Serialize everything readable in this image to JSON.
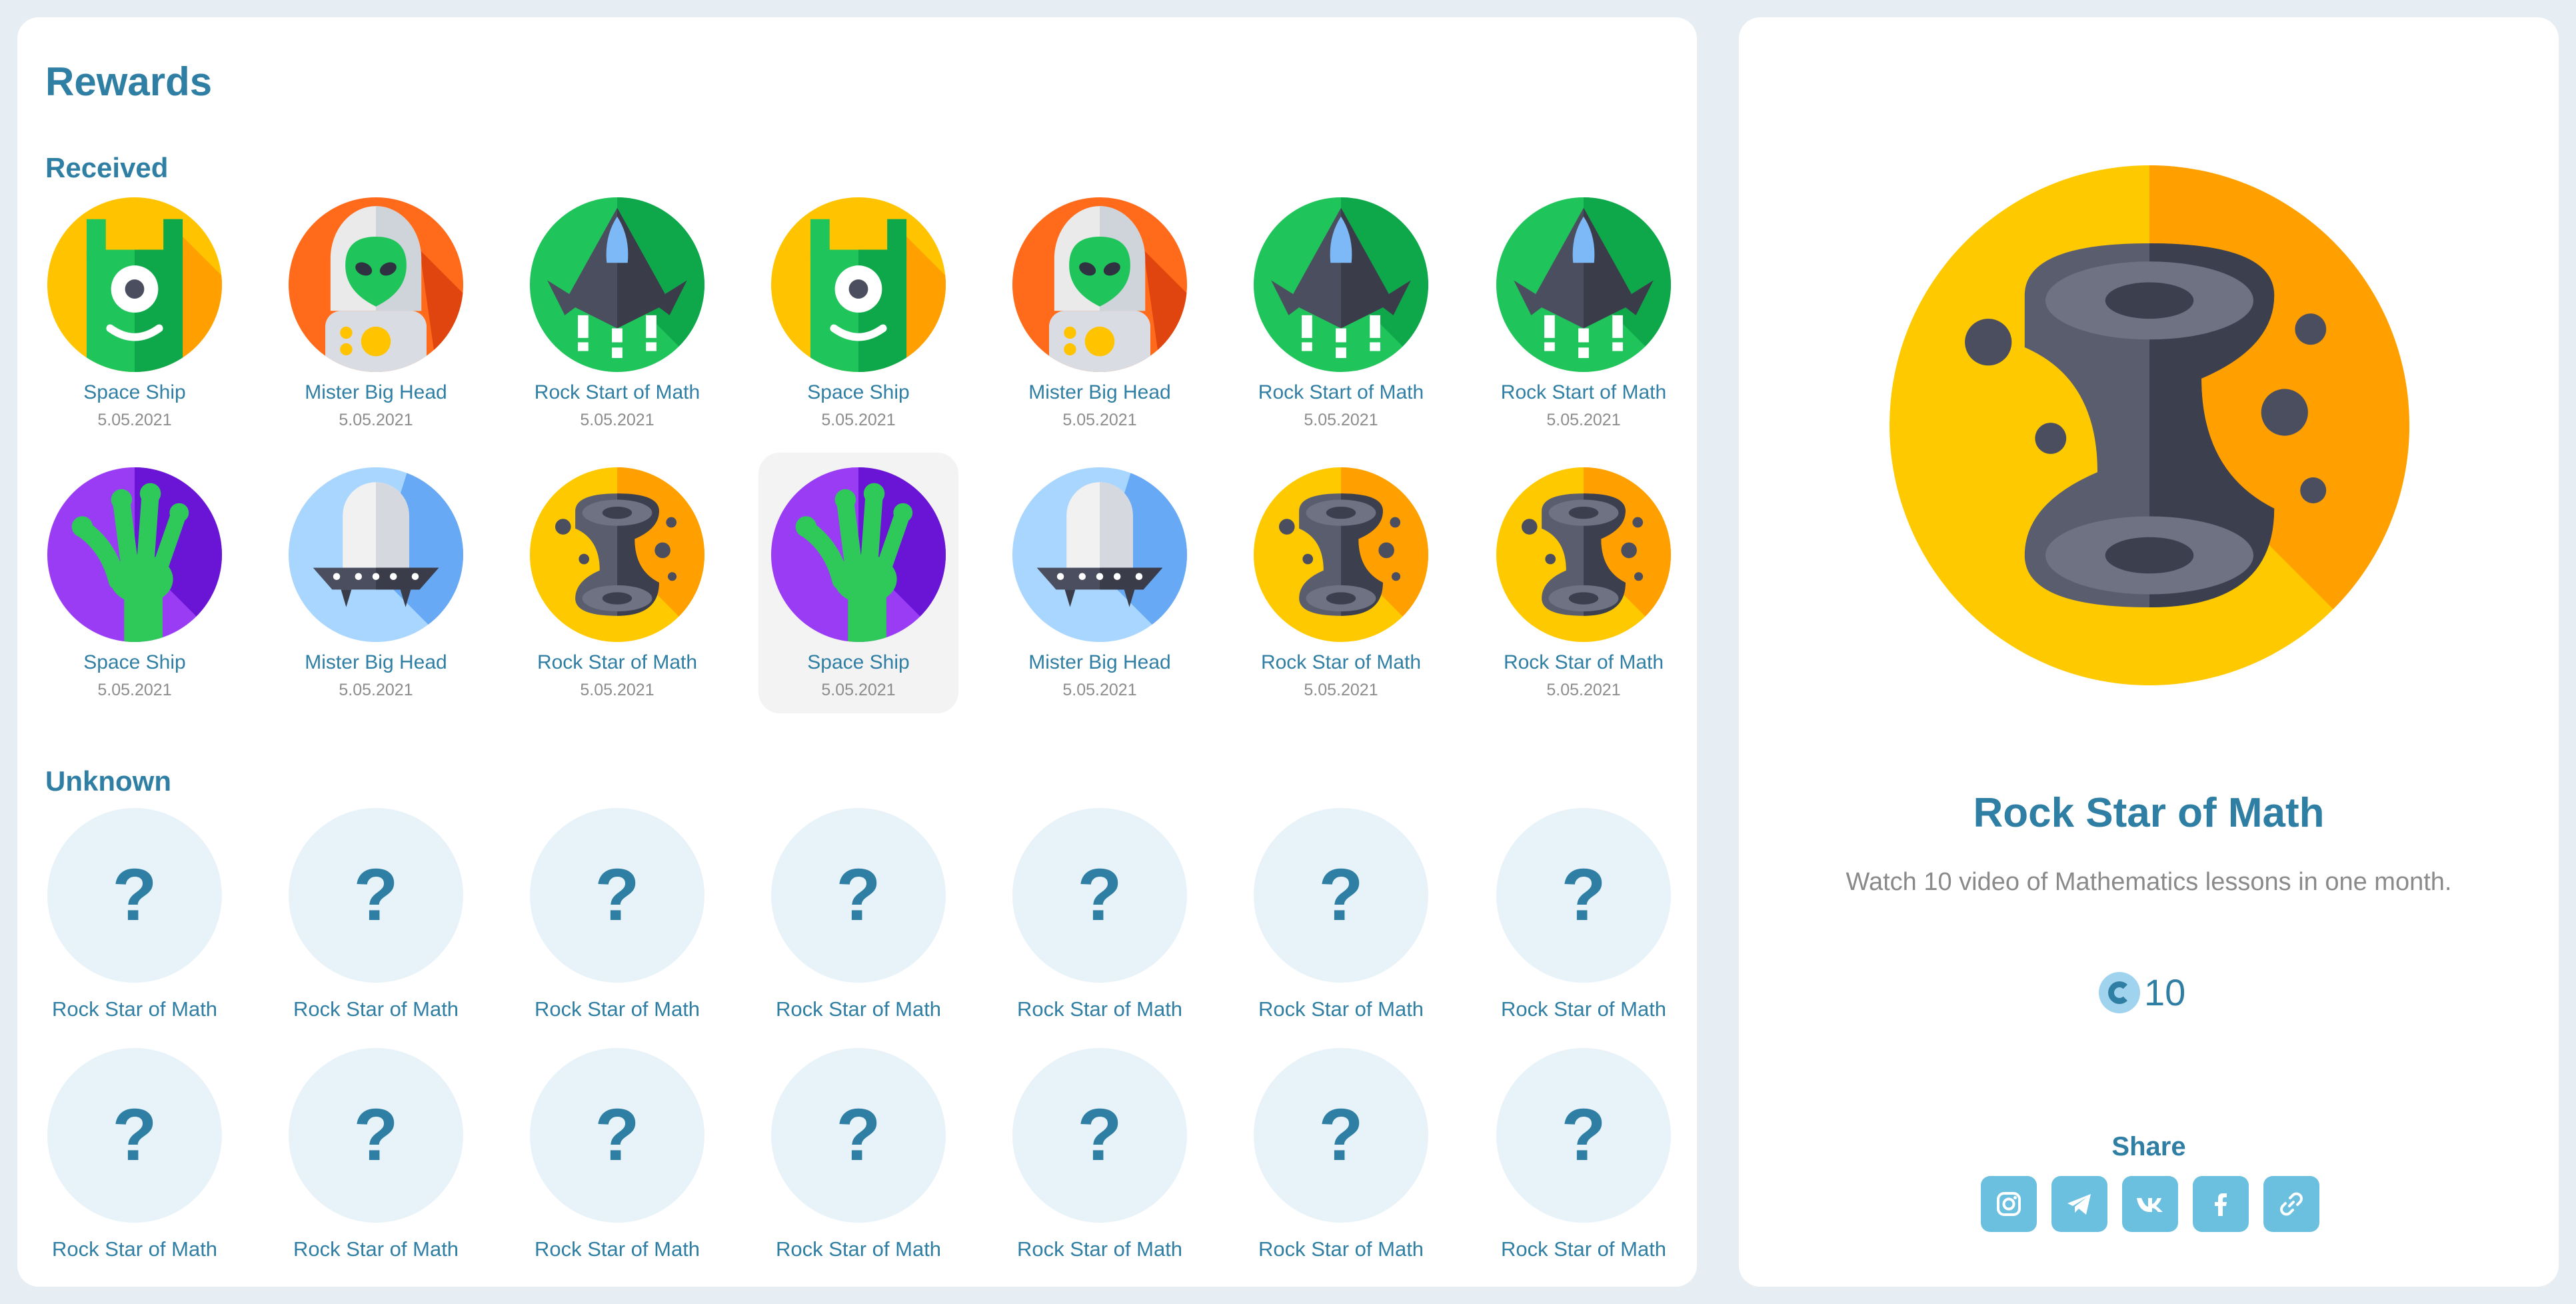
{
  "title": "Rewards",
  "sections": {
    "received": "Received",
    "unknown": "Unknown"
  },
  "received": [
    {
      "name": "Space Ship",
      "date": "5.05.2021",
      "icon": "cyclops-icon"
    },
    {
      "name": "Mister Big Head",
      "date": "5.05.2021",
      "icon": "alien-head-icon"
    },
    {
      "name": "Rock Start of Math",
      "date": "5.05.2021",
      "icon": "spaceship-icon"
    },
    {
      "name": "Space Ship",
      "date": "5.05.2021",
      "icon": "cyclops-icon"
    },
    {
      "name": "Mister Big Head",
      "date": "5.05.2021",
      "icon": "alien-head-icon"
    },
    {
      "name": "Rock Start of Math",
      "date": "5.05.2021",
      "icon": "spaceship-icon"
    },
    {
      "name": "Rock Start of Math",
      "date": "5.05.2021",
      "icon": "spaceship-icon"
    },
    {
      "name": "Space Ship",
      "date": "5.05.2021",
      "icon": "alien-hand-icon"
    },
    {
      "name": "Mister Big Head",
      "date": "5.05.2021",
      "icon": "ufo-icon"
    },
    {
      "name": "Rock Star of Math",
      "date": "5.05.2021",
      "icon": "wormhole-icon"
    },
    {
      "name": "Space Ship",
      "date": "5.05.2021",
      "icon": "alien-hand-icon",
      "selected": true
    },
    {
      "name": "Mister Big Head",
      "date": "5.05.2021",
      "icon": "ufo-icon"
    },
    {
      "name": "Rock Star of Math",
      "date": "5.05.2021",
      "icon": "wormhole-icon"
    },
    {
      "name": "Rock Star of Math",
      "date": "5.05.2021",
      "icon": "wormhole-icon"
    }
  ],
  "unknown": [
    {
      "name": "Rock Star of Math",
      "symbol": "?"
    },
    {
      "name": "Rock Star of Math",
      "symbol": "?"
    },
    {
      "name": "Rock Star of Math",
      "symbol": "?"
    },
    {
      "name": "Rock Star of Math",
      "symbol": "?"
    },
    {
      "name": "Rock Star of Math",
      "symbol": "?"
    },
    {
      "name": "Rock Star of Math",
      "symbol": "?"
    },
    {
      "name": "Rock Star of Math",
      "symbol": "?"
    },
    {
      "name": "Rock Star of Math",
      "symbol": "?"
    },
    {
      "name": "Rock Star of Math",
      "symbol": "?"
    },
    {
      "name": "Rock Star of Math",
      "symbol": "?"
    },
    {
      "name": "Rock Star of Math",
      "symbol": "?"
    },
    {
      "name": "Rock Star of Math",
      "symbol": "?"
    },
    {
      "name": "Rock Star of Math",
      "symbol": "?"
    },
    {
      "name": "Rock Star of Math",
      "symbol": "?"
    }
  ],
  "detail": {
    "title": "Rock Star of Math",
    "description": "Watch 10 video of Mathematics lessons in one month.",
    "points": "10",
    "icon": "wormhole-icon",
    "share_label": "Share",
    "share_buttons": [
      "instagram-icon",
      "telegram-icon",
      "vk-icon",
      "facebook-icon",
      "link-icon"
    ]
  },
  "colors": {
    "accent": "#2f7ea3",
    "share_button": "#6cc0df",
    "unknown_bg": "#e8f3f9",
    "page_bg": "#e7eef3"
  }
}
